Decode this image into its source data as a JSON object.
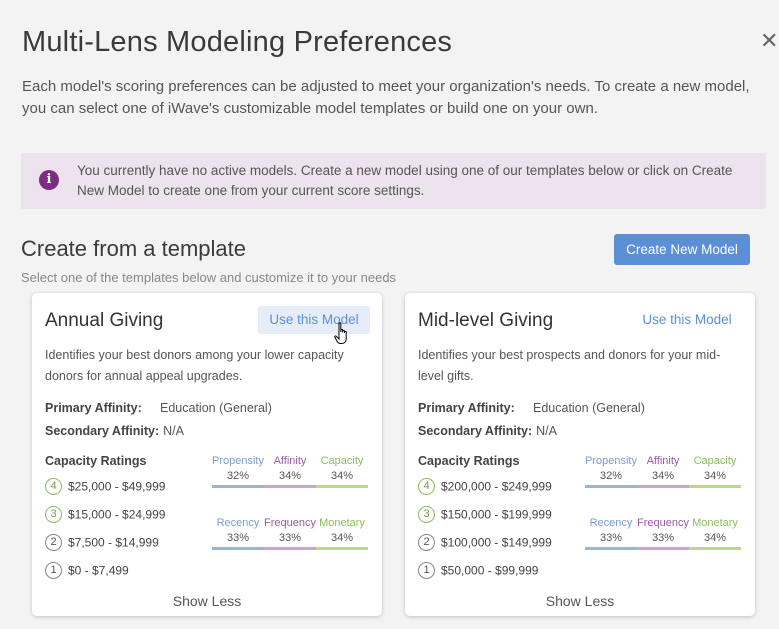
{
  "header": {
    "title": "Multi-Lens Modeling Preferences",
    "close_label": "✕",
    "intro": "Each model's scoring preferences can be adjusted to meet your organization's needs. To create a new model, you can select one of iWave's customizable model templates or build one on your own."
  },
  "banner": {
    "icon": "i",
    "message": "You currently have no active models. Create a new model using one of our templates below or click on Create New Model to create one from your current score settings."
  },
  "section": {
    "title": "Create from a template",
    "subtitle": "Select one of the templates below and customize it to your needs",
    "create_button": "Create New Model"
  },
  "colors": {
    "propensity": "#7b9bd1",
    "affinity": "#9a5aa6",
    "capacity": "#8bbf5a",
    "propensity_bar": "#9ab3d6",
    "affinity_bar": "#c9a6cf",
    "capacity_bar": "#b8d98e",
    "accent": "#5b8fd6"
  },
  "cards": [
    {
      "title": "Annual Giving",
      "use_label": "Use this Model",
      "description": "Identifies your best donors among your lower capacity donors for annual appeal upgrades.",
      "primary_label": "Primary Affinity:",
      "primary_value": "Education (General)",
      "secondary_label": "Secondary Affinity:",
      "secondary_value": "N/A",
      "capacity_heading": "Capacity Ratings",
      "ratings": [
        {
          "num": "4",
          "range": "$25,000 - $49,999"
        },
        {
          "num": "3",
          "range": "$15,000 - $24,999"
        },
        {
          "num": "2",
          "range": "$7,500 - $14,999"
        },
        {
          "num": "1",
          "range": "$0 - $7,499"
        }
      ],
      "weights_top": [
        {
          "name": "Propensity",
          "value": "32%"
        },
        {
          "name": "Affinity",
          "value": "34%"
        },
        {
          "name": "Capacity",
          "value": "34%"
        }
      ],
      "weights_bottom": [
        {
          "name": "Recency",
          "value": "33%"
        },
        {
          "name": "Frequency",
          "value": "33%"
        },
        {
          "name": "Monetary",
          "value": "34%"
        }
      ],
      "show_less": "Show Less"
    },
    {
      "title": "Mid-level Giving",
      "use_label": "Use this Model",
      "description": "Identifies your best prospects and donors for your mid-level gifts.",
      "primary_label": "Primary Affinity:",
      "primary_value": "Education (General)",
      "secondary_label": "Secondary Affinity:",
      "secondary_value": "N/A",
      "capacity_heading": "Capacity Ratings",
      "ratings": [
        {
          "num": "4",
          "range": "$200,000 - $249,999"
        },
        {
          "num": "3",
          "range": "$150,000 - $199,999"
        },
        {
          "num": "2",
          "range": "$100,000 - $149,999"
        },
        {
          "num": "1",
          "range": "$50,000 - $99,999"
        }
      ],
      "weights_top": [
        {
          "name": "Propensity",
          "value": "32%"
        },
        {
          "name": "Affinity",
          "value": "34%"
        },
        {
          "name": "Capacity",
          "value": "34%"
        }
      ],
      "weights_bottom": [
        {
          "name": "Recency",
          "value": "33%"
        },
        {
          "name": "Frequency",
          "value": "33%"
        },
        {
          "name": "Monetary",
          "value": "34%"
        }
      ],
      "show_less": "Show Less"
    }
  ]
}
